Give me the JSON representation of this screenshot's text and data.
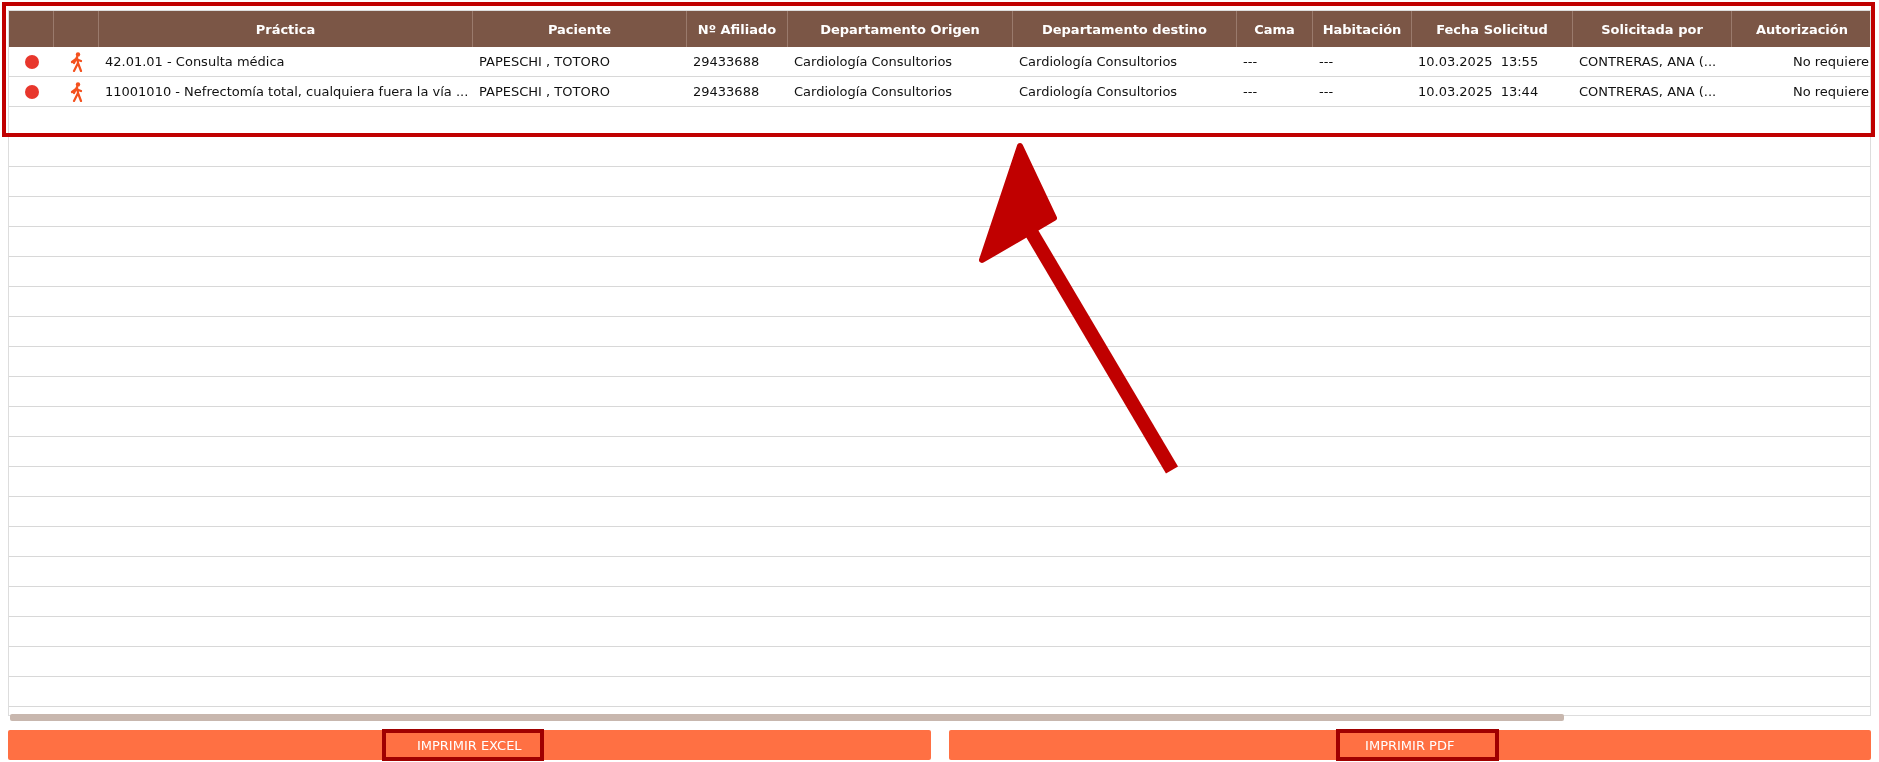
{
  "table": {
    "columns": [
      {},
      {},
      {
        "label": "Práctica"
      },
      {
        "label": "Paciente"
      },
      {
        "label": "Nº Afiliado"
      },
      {
        "label": "Departamento Origen"
      },
      {
        "label": "Departamento destino"
      },
      {
        "label": "Cama"
      },
      {
        "label": "Habitación"
      },
      {
        "label": "Fecha Solicitud"
      },
      {
        "label": "Solicitada por"
      },
      {
        "label": "Autorización"
      }
    ],
    "rows": [
      {
        "color": "#e8372c",
        "practica": "42.01.01 - Consulta médica",
        "paciente": "PAPESCHI , TOTORO",
        "afiliado": "29433688",
        "origen": "Cardiología Consultorios",
        "destino": "Cardiología Consultorios",
        "cama": "---",
        "habitacion": "---",
        "fecha": "10.03.2025  13:55",
        "solicitada": "CONTRERAS, ANA (...",
        "autorizacion": "No requiere"
      },
      {
        "color": "#e8372c",
        "practica": "11001010 - Nefrectomía total, cualquiera fuera la vía ...",
        "paciente": "PAPESCHI , TOTORO",
        "afiliado": "29433688",
        "origen": "Cardiología Consultorios",
        "destino": "Cardiología Consultorios",
        "cama": "---",
        "habitacion": "---",
        "fecha": "10.03.2025  13:44",
        "solicitada": "CONTRERAS, ANA (...",
        "autorizacion": "No requiere"
      }
    ]
  },
  "buttons": [
    {
      "label": "IMPRIMIR EXCEL"
    },
    {
      "label": "IMPRIMIR PDF"
    }
  ]
}
